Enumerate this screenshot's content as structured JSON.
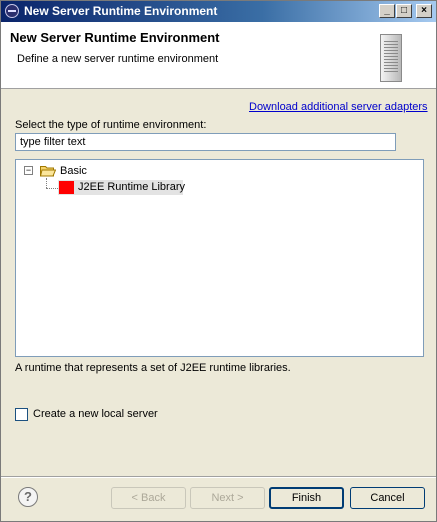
{
  "window": {
    "title": "New Server Runtime Environment",
    "controls": {
      "minimize": "_",
      "maximize": "□",
      "close": "×"
    }
  },
  "header": {
    "title": "New Server Runtime Environment",
    "description": "Define a new server runtime environment"
  },
  "download_link": "Download additional server adapters",
  "select_label": "Select the type of runtime environment:",
  "filter": {
    "value": "type filter text"
  },
  "tree": {
    "folder": {
      "label": "Basic",
      "expanded": true,
      "expander": "−"
    },
    "items": [
      {
        "label": "J2EE Runtime Library",
        "selected": true,
        "icon_color": "#ff0000"
      }
    ]
  },
  "runtime_description": "A runtime that represents a set of J2EE runtime libraries.",
  "create_server": {
    "label": "Create a new local server",
    "checked": false
  },
  "help": {
    "glyph": "?"
  },
  "buttons": {
    "back": "< Back",
    "next": "Next >",
    "finish": "Finish",
    "cancel": "Cancel"
  },
  "colors": {
    "title_bar": "#0a246a",
    "link": "#0000cc",
    "selection": "#e3e3e3"
  }
}
